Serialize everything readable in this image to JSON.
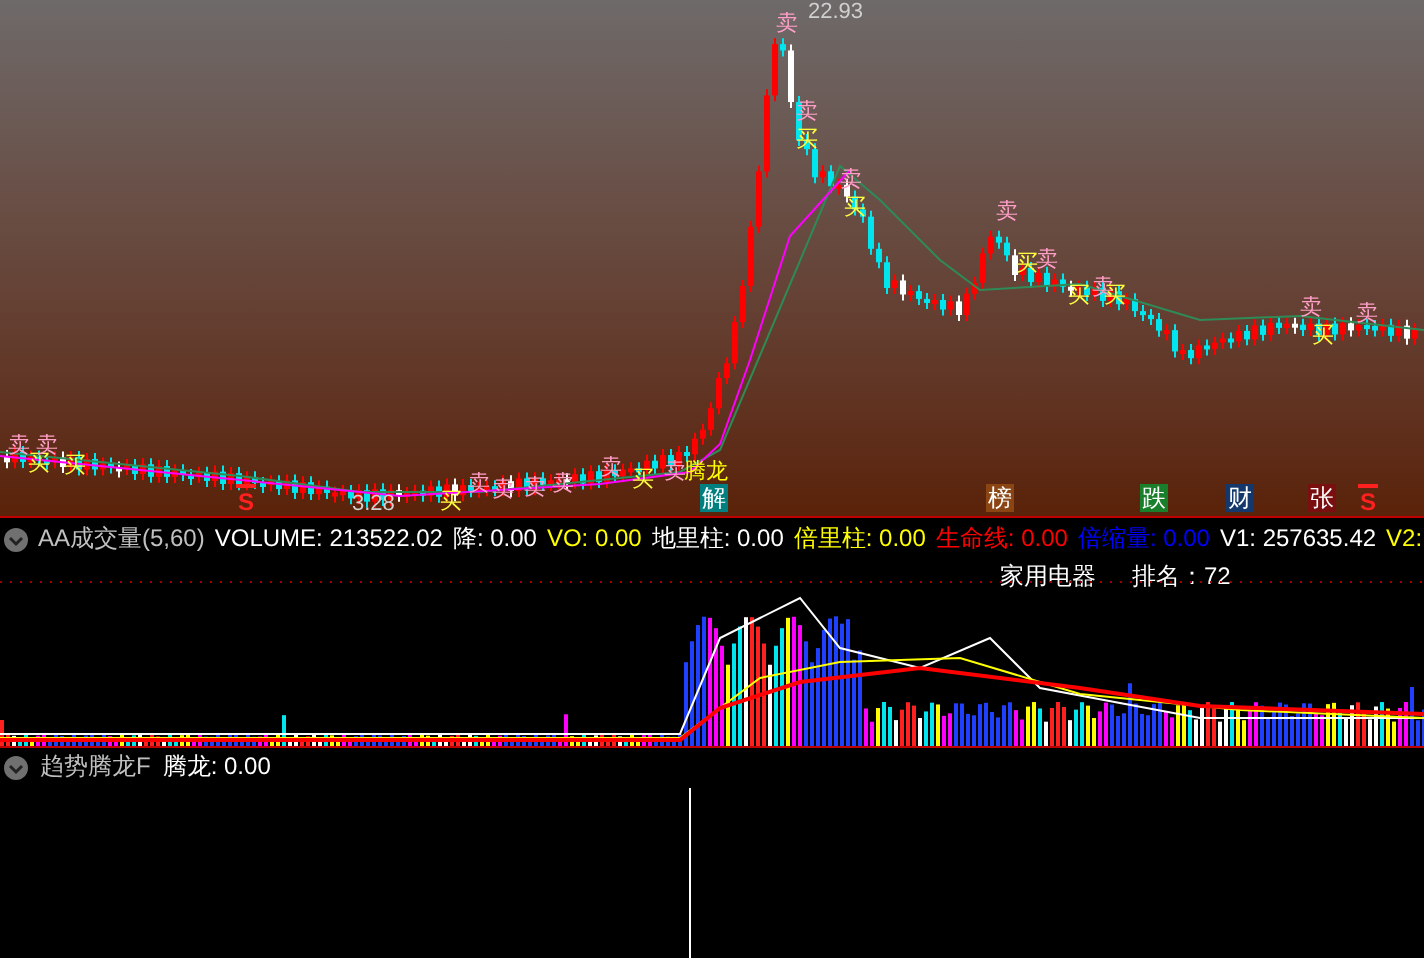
{
  "price_chart": {
    "high_label": "22.93",
    "low_label": "3.28",
    "signals": [
      {
        "text": "卖",
        "kind": "sell"
      },
      {
        "text": "买",
        "kind": "buy"
      },
      {
        "text": "卖",
        "kind": "sell"
      },
      {
        "text": "买",
        "kind": "buy"
      },
      {
        "text": "买",
        "kind": "buy"
      },
      {
        "text": "卖",
        "kind": "sell"
      },
      {
        "text": "卖",
        "kind": "sell"
      },
      {
        "text": "卖",
        "kind": "sell"
      },
      {
        "text": "卖",
        "kind": "sell"
      },
      {
        "text": "卖",
        "kind": "sell"
      },
      {
        "text": "买",
        "kind": "buy"
      },
      {
        "text": "卖",
        "kind": "sell"
      },
      {
        "text": "腾龙",
        "kind": "dragon"
      },
      {
        "text": "卖",
        "kind": "sell"
      },
      {
        "text": "卖",
        "kind": "sell"
      },
      {
        "text": "买",
        "kind": "buy"
      },
      {
        "text": "卖",
        "kind": "sell"
      },
      {
        "text": "买",
        "kind": "buy"
      },
      {
        "text": "卖",
        "kind": "sell"
      },
      {
        "text": "买",
        "kind": "buy"
      },
      {
        "text": "卖",
        "kind": "sell"
      },
      {
        "text": "买",
        "kind": "buy"
      },
      {
        "text": "卖",
        "kind": "sell"
      },
      {
        "text": "买",
        "kind": "buy"
      },
      {
        "text": "卖",
        "kind": "sell"
      },
      {
        "text": "买",
        "kind": "buy"
      },
      {
        "text": "卖",
        "kind": "sell"
      }
    ],
    "events": [
      {
        "text": "S",
        "kind": "flag"
      },
      {
        "text": "解",
        "kind": "tag",
        "color": "#008080"
      },
      {
        "text": "榜",
        "kind": "tag",
        "color": "#8b4513"
      },
      {
        "text": "跌",
        "kind": "tag",
        "color": "#1a7f2a"
      },
      {
        "text": "财",
        "kind": "tag",
        "color": "#14386b"
      },
      {
        "text": "张",
        "kind": "tag",
        "color": "#7a0f0f"
      },
      {
        "text": "S",
        "kind": "flag"
      }
    ]
  },
  "volume_panel": {
    "legend": [
      {
        "text": "AA成交量(5,60)",
        "color": "#c0c0c0"
      },
      {
        "text": "VOLUME: 213522.02",
        "color": "#ffffff"
      },
      {
        "text": "降: 0.00",
        "color": "#ffffff"
      },
      {
        "text": "VO: 0.00",
        "color": "#ffff00"
      },
      {
        "text": "地里柱: 0.00",
        "color": "#ffffff"
      },
      {
        "text": "倍里柱: 0.00",
        "color": "#ffff00"
      },
      {
        "text": "生命线: 0.00",
        "color": "#ff0000"
      },
      {
        "text": "倍缩量: 0.00",
        "color": "#0000ff"
      },
      {
        "text": "V1: 257635.42",
        "color": "#ffffff"
      },
      {
        "text": "V2:",
        "color": "#ffff00"
      }
    ],
    "sector": "家用电器",
    "rank": "排名：72"
  },
  "trend_panel": {
    "legend": [
      {
        "text": "趋势腾龙F",
        "color": "#c0c0c0"
      },
      {
        "text": "腾龙: 0.00",
        "color": "#ffffff"
      }
    ]
  }
}
